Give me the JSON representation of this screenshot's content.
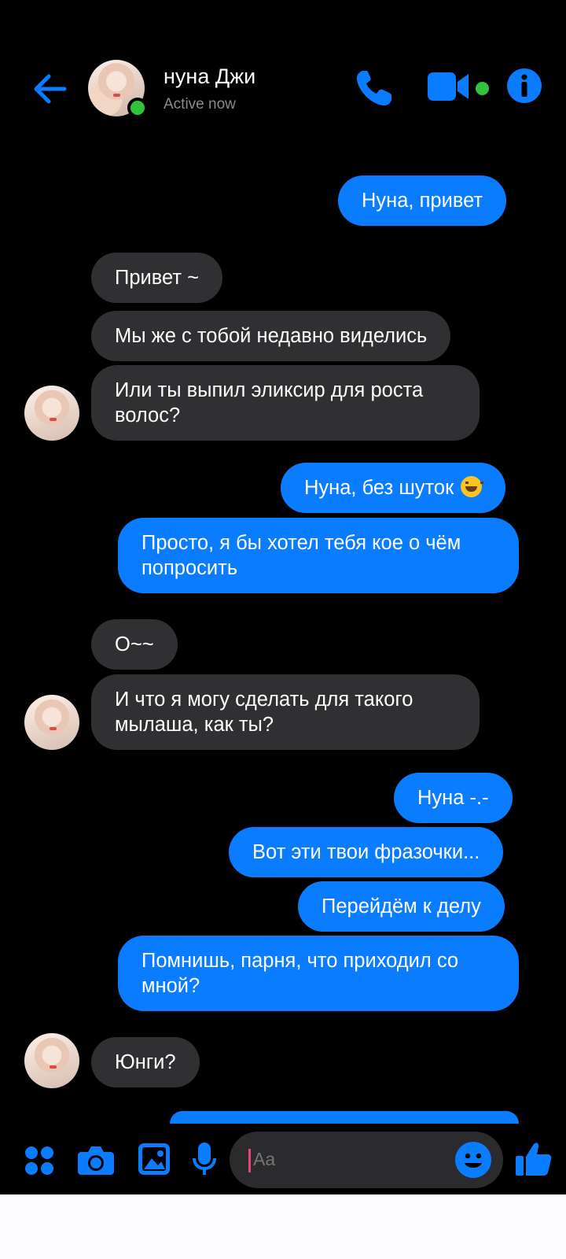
{
  "header": {
    "contact_name": "нуна Джи",
    "status": "Active now",
    "icons": [
      "back-arrow-icon",
      "phone-icon",
      "video-camera-icon",
      "info-icon"
    ]
  },
  "messages": [
    {
      "side": "out",
      "text": "Нуна, привет"
    },
    {
      "side": "in",
      "text": "Привет ~"
    },
    {
      "side": "in",
      "text": "Мы же с тобой недавно виделись"
    },
    {
      "side": "in",
      "lines": [
        "Или ты выпил эликсир для роста",
        "волос?"
      ]
    },
    {
      "side": "out",
      "text": "Нуна, без шуток"
    },
    {
      "side": "out",
      "lines": [
        "Просто, я бы хотел тебя кое о чём",
        "попросить"
      ]
    },
    {
      "side": "in",
      "text": "О~~"
    },
    {
      "side": "in",
      "lines": [
        "И что я могу сделать для такого",
        "мылаша, как ты?"
      ]
    },
    {
      "side": "out",
      "text": "Нуна -.-"
    },
    {
      "side": "out",
      "text": "Вот эти твои фразочки..."
    },
    {
      "side": "out",
      "text": "Перейдём к делу"
    },
    {
      "side": "out",
      "lines": [
        "Помнишь, парня, что приходил со",
        "мной?"
      ]
    },
    {
      "side": "in",
      "text": "Юнги?"
    }
  ],
  "composer": {
    "placeholder": "Aa"
  },
  "colors": {
    "accent": "#0a7cff",
    "incoming_bubble": "#303033",
    "online": "#31c43b",
    "background": "#000000"
  }
}
